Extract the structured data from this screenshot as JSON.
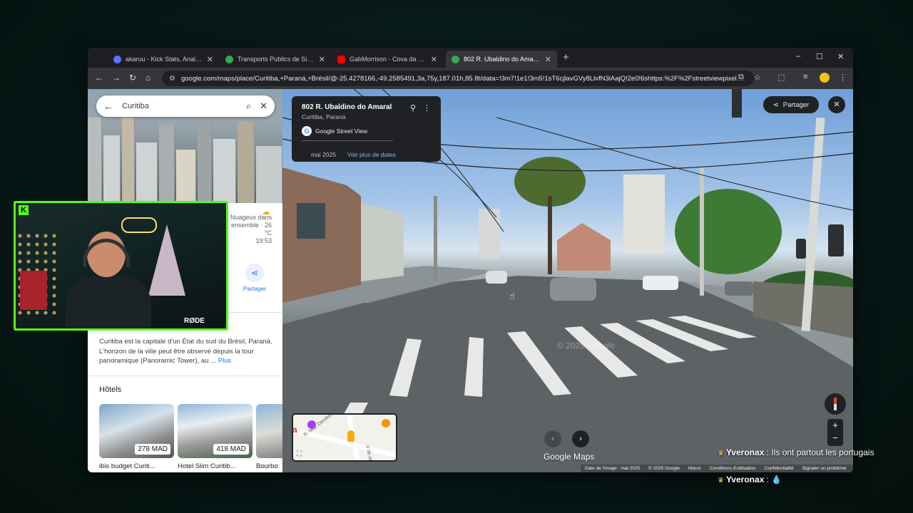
{
  "tabs": [
    {
      "title": "akaruu - Kick Stats, Analytics an",
      "favicon_color": "#5f6fff",
      "active": false
    },
    {
      "title": "Transports Publics de Sintra, Po",
      "favicon_color": "#34a853",
      "active": false
    },
    {
      "title": "GabMorrison - Cova da Moura",
      "favicon_color": "#ff0000",
      "active": false
    },
    {
      "title": "802 R. Ubaldino do Amaral - Go",
      "favicon_color": "#34a853",
      "active": true
    }
  ],
  "new_tab": "+",
  "window": {
    "minimize": "–",
    "maximize": "☐",
    "close": "✕"
  },
  "toolbar": {
    "back": "←",
    "forward": "→",
    "reload": "↻",
    "home": "⌂"
  },
  "omnibox": {
    "url": "google.com/maps/place/Curitiba,+Paraná,+Brésil/@-25.4278166,-49.2585491,3a,75y,187.01h,85.8t/data=!3m7!1e1!3m5!1sT6cjlavGVy8LlvfN3iAajQ!2e0!6shttps:%2F%2Fstreetviewpixels-pa..."
  },
  "panel": {
    "search_query": "Curitiba",
    "weather_text": "Nuageux dans ensemble · 26 °C",
    "weather_time": "19:53",
    "share_label": "Partager",
    "description": "Curitiba est la capitale d'un État du sud du Brésil, Paraná. L'horizon de la ville peut être observé depuis la tour panoramique (Panoramic Tower), au ...",
    "more_label": "Plus",
    "hotels_heading": "Hôtels",
    "hotels": [
      {
        "name": "ibis budget Curiti...",
        "price": "278 MAD"
      },
      {
        "name": "Hotel Slim Curitib...",
        "price": "418 MAD"
      },
      {
        "name": "Bourbo",
        "price": ""
      }
    ]
  },
  "streetview": {
    "address": "802 R. Ubaldino do Amaral",
    "city": "Curitiba, Paraná",
    "provider": "Google Street View",
    "capture_date": "mai 2025",
    "see_more_dates": "Voir plus de dates",
    "share_button": "Partager",
    "road_label": "R. Ubaldino do Amaral",
    "watermark": "© 2025 Google",
    "minimap": {
      "street1": "R. Mal. Deodoro",
      "street2": "e de Abril"
    },
    "brand": "Google Maps",
    "footer": [
      "Date de l'image : mai 2025",
      "© 2025 Google",
      "Maroc",
      "Conditions d'utilisation",
      "Confidentialité",
      "Signaler un problème"
    ]
  },
  "stream": {
    "platform_logo": "K",
    "mic_brand": "RØDE",
    "chat": [
      {
        "user": "Yveronax",
        "message": "Ils ont partout les portugais"
      },
      {
        "user": "Yveronax",
        "message": "💧"
      }
    ]
  },
  "colors": {
    "kick_green": "#53fc18",
    "maps_blue": "#1a73e8",
    "chrome_dark": "#202124"
  }
}
